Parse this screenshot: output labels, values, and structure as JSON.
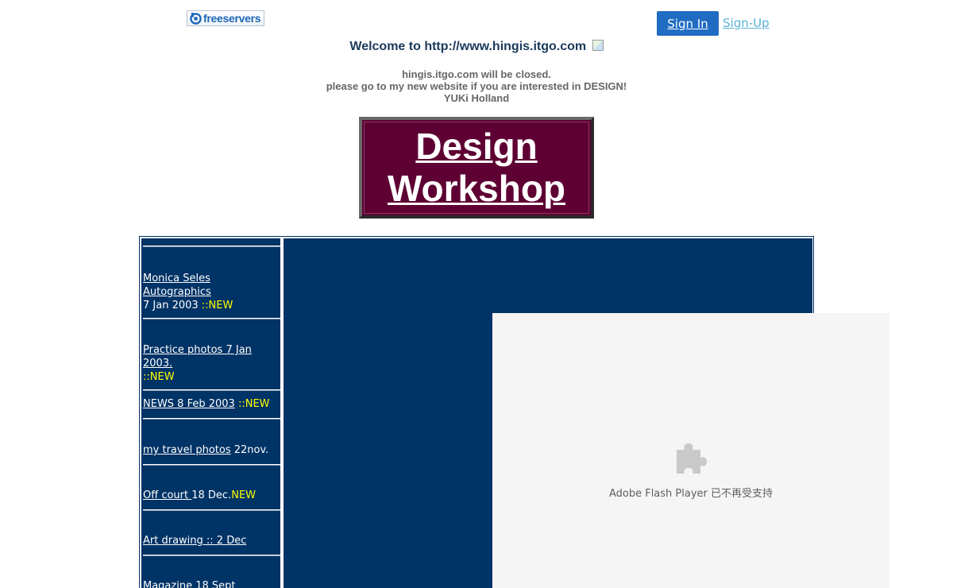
{
  "header": {
    "logo_text": "freeservers",
    "signin_label": "Sign In",
    "signup_label": "Sign-Up"
  },
  "welcome": {
    "text": "Welcome to http://www.hingis.itgo.com"
  },
  "notice": {
    "line1": "hingis.itgo.com will be closed.",
    "line2": "please go to my new website if you are interested in DESIGN!",
    "line3": "YUKi Holland"
  },
  "banner": {
    "line1": "Design",
    "line2": "Workshop"
  },
  "sidebar": {
    "items": [
      {
        "link": "Monica Seles Autographics",
        "text": "7 Jan 2003 ",
        "new": "::NEW"
      },
      {
        "link": "Practice photos 7 Jan 2003.",
        "text": "",
        "new": "::NEW"
      },
      {
        "link": "NEWS 8 Feb 2003",
        "text": " ",
        "new": "::NEW"
      },
      {
        "link": "my travel photos",
        "text": " 22nov.",
        "new": ""
      },
      {
        "link": "Off court ",
        "text": "18 Dec.",
        "new": "NEW"
      },
      {
        "link": "Art drawing :: 2 Dec",
        "text": "",
        "new": ""
      },
      {
        "link": "Magazine 18 Sept",
        "text": "",
        "new": ""
      }
    ]
  },
  "flash": {
    "message": "Adobe Flash Player 已不再受支持"
  },
  "colors": {
    "navy": "#003366",
    "banner": "#5e0033",
    "new_badge": "#ffff00",
    "signin_button": "#1f6cc2"
  }
}
